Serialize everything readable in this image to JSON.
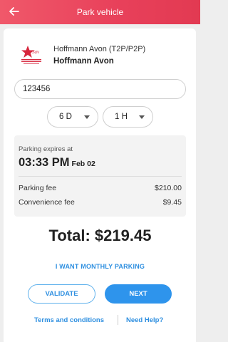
{
  "header": {
    "title": "Park vehicle",
    "back_icon": "arrow-left-icon",
    "background_color": "#e8405a"
  },
  "merchant": {
    "logo_icon": "star-logo-icon",
    "subtitle": "Hoffmann Avon (T2P/P2P)",
    "name": "Hoffmann Avon"
  },
  "plate_input": {
    "value": "123456"
  },
  "duration": {
    "days": "6 D",
    "hours": "1 H"
  },
  "summary": {
    "expires_label": "Parking expires at",
    "expires_time": "03:33 PM",
    "expires_date": "Feb 02",
    "fees": [
      {
        "label": "Parking fee",
        "amount": "$210.00"
      },
      {
        "label": "Convenience fee",
        "amount": "$9.45"
      }
    ]
  },
  "total": "Total: $219.45",
  "monthly_link": "I WANT MONTHLY PARKING",
  "buttons": {
    "validate": "VALIDATE",
    "next": "NEXT"
  },
  "footer": {
    "terms": "Terms and conditions",
    "help": "Need Help?"
  },
  "colors": {
    "accent": "#2e8fe0",
    "header": "#e8405a"
  }
}
